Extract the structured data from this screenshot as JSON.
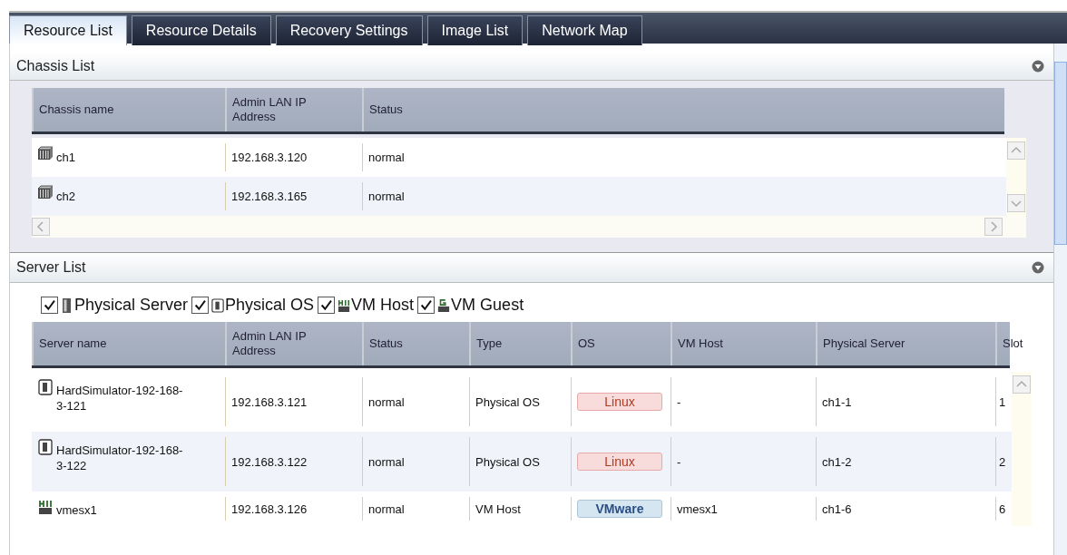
{
  "tabs": [
    {
      "label": "Resource List",
      "selected": true
    },
    {
      "label": "Resource Details",
      "selected": false
    },
    {
      "label": "Recovery Settings",
      "selected": false
    },
    {
      "label": "Image List",
      "selected": false
    },
    {
      "label": "Network Map",
      "selected": false
    }
  ],
  "chassis_list": {
    "title": "Chassis List",
    "columns": [
      "Chassis name",
      "Admin LAN IP Address",
      "Status"
    ],
    "rows": [
      {
        "name": "ch1",
        "ip": "192.168.3.120",
        "status": "normal"
      },
      {
        "name": "ch2",
        "ip": "192.168.3.165",
        "status": "normal"
      }
    ]
  },
  "server_list": {
    "title": "Server List",
    "filters": [
      {
        "label": "Physical Server",
        "kind": "physical_server",
        "checked": true
      },
      {
        "label": "Physical OS",
        "kind": "physical_os",
        "checked": true
      },
      {
        "label": "VM Host",
        "kind": "vm_host",
        "checked": true
      },
      {
        "label": "VM Guest",
        "kind": "vm_guest",
        "checked": true
      }
    ],
    "columns": [
      "Server name",
      "Admin LAN IP Address",
      "Status",
      "Type",
      "OS",
      "VM Host",
      "Physical Server",
      "Slot"
    ],
    "rows": [
      {
        "kind": "physical_os",
        "name": "HardSimulator-192-168-3-121",
        "ip": "192.168.3.121",
        "status": "normal",
        "type": "Physical OS",
        "os": {
          "label": "Linux",
          "kind": "linux"
        },
        "vm_host": "-",
        "physical_server": "ch1-1",
        "slot": "1"
      },
      {
        "kind": "physical_os",
        "name": "HardSimulator-192-168-3-122",
        "ip": "192.168.3.122",
        "status": "normal",
        "type": "Physical OS",
        "os": {
          "label": "Linux",
          "kind": "linux"
        },
        "vm_host": "-",
        "physical_server": "ch1-2",
        "slot": "2"
      },
      {
        "kind": "vm_host",
        "name": "vmesx1",
        "ip": "192.168.3.126",
        "status": "normal",
        "type": "VM Host",
        "os": {
          "label": "VMware",
          "kind": "vmware"
        },
        "vm_host": "vmesx1",
        "physical_server": "ch1-6",
        "slot": "6"
      }
    ]
  }
}
